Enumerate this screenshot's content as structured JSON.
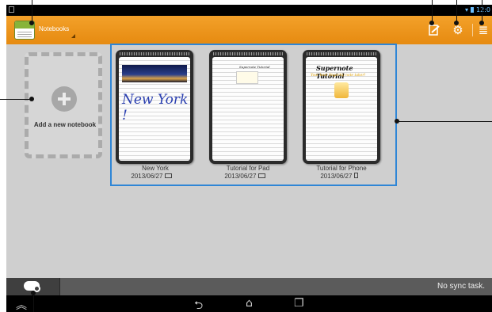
{
  "actionbar": {
    "title": "Notebooks",
    "icons": [
      "supernote-app-icon",
      "edit-page-icon",
      "settings-gear-icon",
      "menu-icon"
    ]
  },
  "statusbar": {
    "time": "12:0"
  },
  "add_notebook": {
    "label": "Add a new notebook"
  },
  "notebooks": [
    {
      "name": "New York",
      "date": "2013/06/27",
      "cover_text": "New York !"
    },
    {
      "name": "Tutorial for Pad",
      "date": "2013/06/27",
      "cover_title": "Supernote Tutorial"
    },
    {
      "name": "Tutorial for Phone",
      "date": "2013/06/27",
      "cover_title": "Supernote Tutorial",
      "cover_subtitle": "Your best fingertip note taker!"
    }
  ],
  "bottombar": {
    "sync_status": "No sync task."
  },
  "colors": {
    "actionbar": "#e98f12",
    "selection": "#2f86d6",
    "background": "#cfcfcf"
  }
}
